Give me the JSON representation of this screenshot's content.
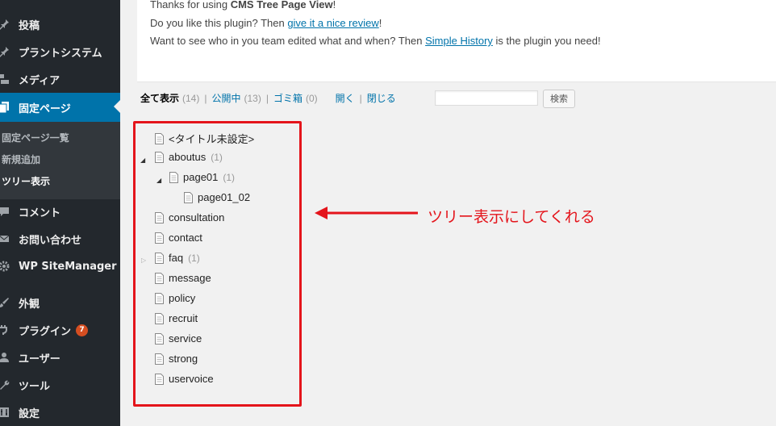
{
  "sidebar": {
    "items": [
      {
        "label": "投稿",
        "icon": "pin-icon"
      },
      {
        "label": "プラントシステム",
        "icon": "pin-icon"
      },
      {
        "label": "メディア",
        "icon": "media-icon"
      },
      {
        "label": "固定ページ",
        "icon": "pages-icon"
      },
      {
        "label": "コメント",
        "icon": "comment-icon"
      },
      {
        "label": "お問い合わせ",
        "icon": "mail-icon"
      },
      {
        "label": "WP SiteManager",
        "icon": "gear-icon"
      },
      {
        "label": "外観",
        "icon": "brush-icon"
      },
      {
        "label": "プラグイン",
        "icon": "plugin-icon",
        "badge": "7"
      },
      {
        "label": "ユーザー",
        "icon": "user-icon"
      },
      {
        "label": "ツール",
        "icon": "wrench-icon"
      },
      {
        "label": "設定",
        "icon": "settings-icon"
      }
    ],
    "submenu": [
      "固定ページ一覧",
      "新規追加",
      "ツリー表示"
    ]
  },
  "notice": {
    "line1_prefix": "Thanks for using ",
    "line1_bold": "CMS Tree Page View",
    "line1_suffix": "!",
    "line2_prefix": "Do you like this plugin? Then ",
    "line2_link": "give it a nice review",
    "line2_suffix": "!",
    "line3_prefix": "Want to see who in you team edited what and when? Then ",
    "line3_link": "Simple History",
    "line3_suffix": " is the plugin you need!"
  },
  "filters": {
    "all_label": "全て表示",
    "all_count": "(14)",
    "published_label": "公開中",
    "published_count": "(13)",
    "trash_label": "ゴミ箱",
    "trash_count": "(0)",
    "open_label": "開く",
    "close_label": "閉じる",
    "sep": "|"
  },
  "search": {
    "button_label": "検索",
    "value": ""
  },
  "tree": [
    {
      "title": "<タイトル未設定>",
      "count": ""
    },
    {
      "title": "aboutus",
      "count": "(1)",
      "toggle": "expanded"
    },
    {
      "title": "page01",
      "count": "(1)",
      "toggle": "expanded"
    },
    {
      "title": "page01_02",
      "count": ""
    },
    {
      "title": "consultation",
      "count": ""
    },
    {
      "title": "contact",
      "count": ""
    },
    {
      "title": "faq",
      "count": "(1)",
      "toggle": "collapsed"
    },
    {
      "title": "message",
      "count": ""
    },
    {
      "title": "policy",
      "count": ""
    },
    {
      "title": "recruit",
      "count": ""
    },
    {
      "title": "service",
      "count": ""
    },
    {
      "title": "strong",
      "count": ""
    },
    {
      "title": "uservoice",
      "count": ""
    }
  ],
  "annotation": {
    "text": "ツリー表示にしてくれる",
    "color": "#e4141b"
  },
  "colors": {
    "sidebar_bg": "#23282d",
    "active_bg": "#0073aa",
    "link": "#0073aa",
    "badge": "#d54e21"
  }
}
